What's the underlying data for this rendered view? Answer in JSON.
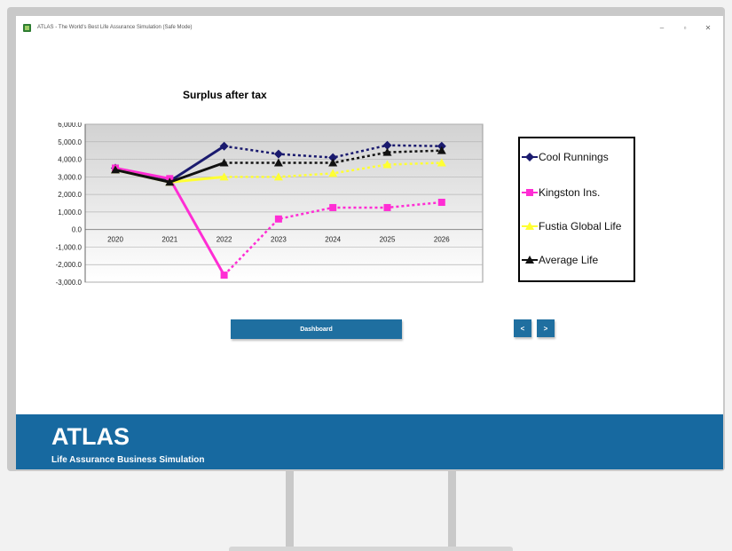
{
  "window": {
    "title": "ATLAS - The World's Best Life Assurance Simulation (Safe Mode)",
    "controls": {
      "minimize": "–",
      "restore": "▫",
      "close": "✕"
    }
  },
  "chart_data": {
    "type": "line",
    "title": "Surplus after tax",
    "categories": [
      "2020",
      "2021",
      "2022",
      "2023",
      "2024",
      "2025",
      "2026"
    ],
    "ylim": [
      -3000,
      6000
    ],
    "yticks": [
      6000,
      5000,
      4000,
      3000,
      2000,
      1000,
      0,
      -1000,
      -2000,
      -3000
    ],
    "ytick_labels": [
      "6,000.0",
      "5,000.0",
      "4,000.0",
      "3,000.0",
      "2,000.0",
      "1,000.0",
      "0.0",
      "-1,000.0",
      "-2,000.0",
      "-3,000.0"
    ],
    "grid": true,
    "legend_position": "right",
    "series": [
      {
        "name": "Cool Runnings",
        "color": "#1a1a6e",
        "marker": "diamond",
        "values": [
          3500,
          2750,
          4750,
          4300,
          4100,
          4800,
          4750
        ]
      },
      {
        "name": "Kingston Ins.",
        "color": "#ff2dd4",
        "marker": "square",
        "values": [
          3500,
          2900,
          -2600,
          600,
          1250,
          1250,
          1550
        ]
      },
      {
        "name": "Fustia Global Life",
        "color": "#ffff33",
        "marker": "triangle",
        "values": [
          3400,
          2700,
          3000,
          3000,
          3200,
          3700,
          3800
        ]
      },
      {
        "name": "Average Life",
        "color": "#111111",
        "marker": "triangle",
        "values": [
          3400,
          2700,
          3800,
          3800,
          3800,
          4400,
          4500
        ]
      }
    ]
  },
  "buttons": {
    "dashboard": "Dashboard",
    "prev": "<",
    "next": ">"
  },
  "banner": {
    "title": "ATLAS",
    "subtitle": "Life Assurance Business Simulation"
  },
  "colors": {
    "accent": "#1769a0",
    "button": "#1f6fa0"
  }
}
